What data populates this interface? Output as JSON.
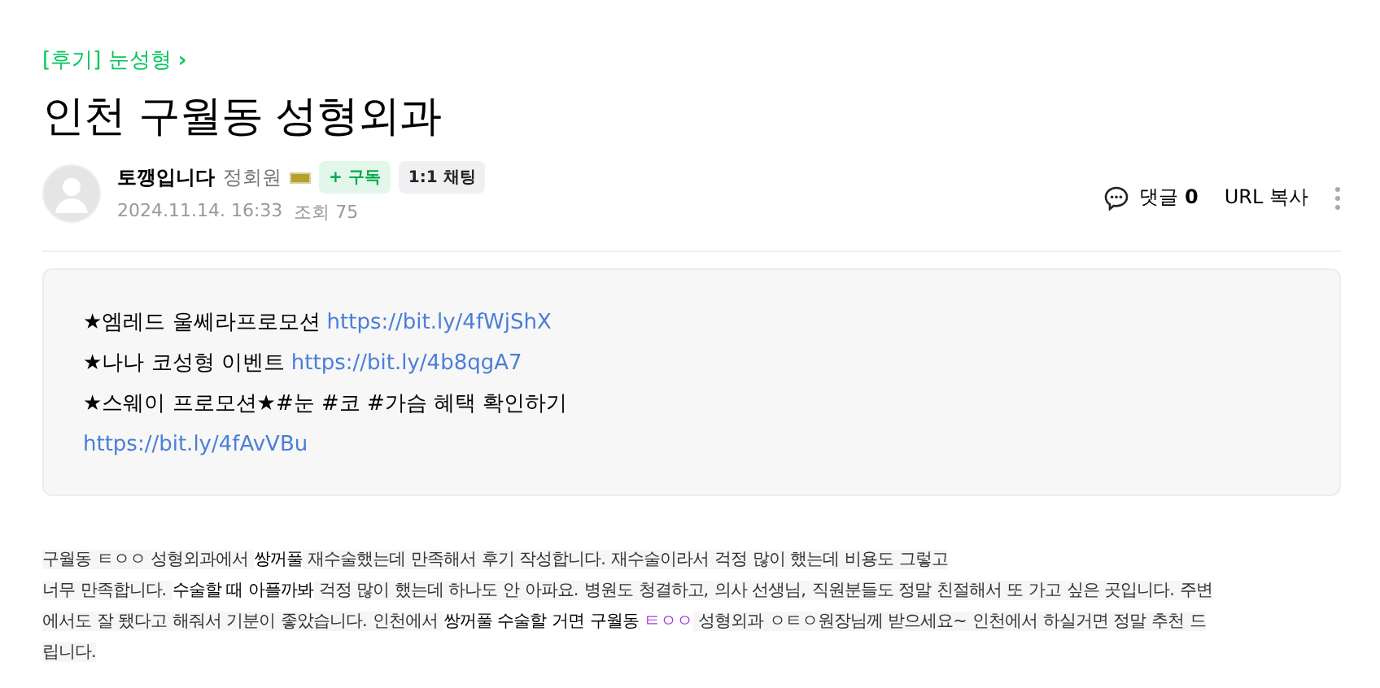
{
  "board_link": {
    "label": "[후기] 눈성형",
    "arrow": "›"
  },
  "title": "인천 구월동 성형외과",
  "author": {
    "name": "토깽입니다",
    "rank": "정회원",
    "subscribe": "+ 구독",
    "chat": "1:1 채팅",
    "date": "2024.11.14. 16:33",
    "views": "조회 75"
  },
  "actions": {
    "comments_label": "댓글",
    "comments_count": "0",
    "url_copy": "URL 복사"
  },
  "promo_box": {
    "lines": [
      {
        "text": "★엠레드 울쎄라프로모션",
        "link": "https://bit.ly/4fWjShX"
      },
      {
        "text": "★나나 코성형 이벤트",
        "link": "https://bit.ly/4b8qgA7"
      },
      {
        "text": "★스웨이 프로모션★#눈 #코 #가슴 혜택 확인하기"
      },
      {
        "link": "https://bit.ly/4fAvVBu"
      }
    ]
  },
  "body_lines": [
    [
      {
        "text": "구월동 ㅌㅇㅇ 성형외과에서 ",
        "kind": "shaded"
      },
      {
        "text": "쌍꺼풀",
        "kind": "strong"
      },
      {
        "text": " 재수술했는데 만족해서 후기 작성합니다. 재수술이라서 걱정 많이 했는데 비용도 그렇고",
        "kind": "shaded"
      }
    ],
    [
      {
        "text": "너무 만족합니다. ",
        "kind": "shaded"
      },
      {
        "text": "수술할 때 아플까봐",
        "kind": "strong"
      },
      {
        "text": " 걱정 많이 했는데 하나도 안 아파요. 병원도 청결하고, 의사 선생님, 직원분들도 정말 친절해서 또 가고 싶은 곳입니다. 주변",
        "kind": "shaded"
      }
    ],
    [
      {
        "text": "에서도 잘 됐다고 해줘서 기분이 좋았습니다. 인천에서 ",
        "kind": "shaded"
      },
      {
        "text": "쌍꺼풀 수술할 거면 구월동 ",
        "kind": "strong"
      },
      {
        "text": "ㅌㅇㅇ",
        "kind": "accent"
      },
      {
        "text": " 성형외과 ㅇㅌㅇ원장님께 받으세요~  인천에서 하실거면 정말 추천 드",
        "kind": "shaded"
      }
    ],
    [
      {
        "text": "립니다.",
        "kind": "shaded"
      }
    ]
  ]
}
